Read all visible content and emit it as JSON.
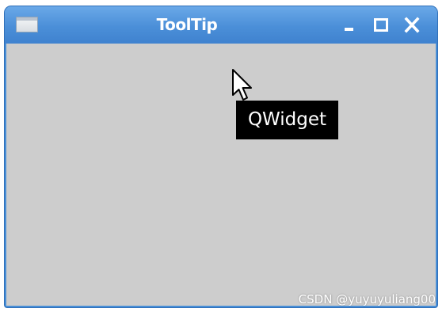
{
  "window": {
    "title": "ToolTip",
    "icons": {
      "app": "window-icon",
      "minimize": "minimize-icon",
      "maximize": "maximize-icon",
      "close": "close-icon"
    }
  },
  "tooltip": {
    "text": "QWidget"
  },
  "cursor": {
    "icon": "arrow-cursor-icon"
  },
  "watermark": {
    "text": "CSDN @yuyuyuliang00"
  },
  "colors": {
    "titlebar": "#4b8fd8",
    "client_background": "#cdcdcd",
    "tooltip_background": "#000000",
    "tooltip_text": "#ffffff"
  }
}
